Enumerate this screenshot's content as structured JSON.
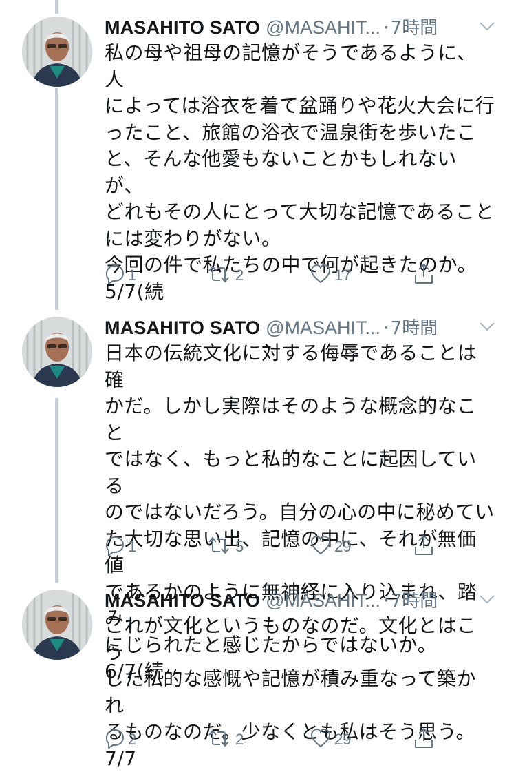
{
  "tweets": [
    {
      "name": "MASAHITO SATO",
      "handle": "@MASAHIT...",
      "dot": "·",
      "time": "7時間",
      "text": "私の母や祖母の記憶がそうであるように、人\nによっては浴衣を着て盆踊りや花火大会に行\nったこと、旅館の浴衣で温泉街を歩いたこ\nと、そんな他愛もないことかもしれないが、\nどれもその人にとって大切な記憶であること\nには変わりがない。\n今回の件で私たちの中で何が起きたのか。\n5/7(続",
      "replies": "1",
      "retweets": "2",
      "likes": "17"
    },
    {
      "name": "MASAHITO SATO",
      "handle": "@MASAHIT...",
      "dot": "·",
      "time": "7時間",
      "text": "日本の伝統文化に対する侮辱であることは確\nかだ。しかし実際はそのような概念的なこと\nではなく、もっと私的なことに起因している\nのではないだろう。自分の心の中に秘めてい\nた大切な思い出、記憶の中に、それが無価値\nであるかのように無神経に入り込まれ、踏み\nにじられたと感じたからではないか。6/7(続",
      "replies": "1",
      "retweets": "5",
      "likes": "29"
    },
    {
      "name": "MASAHITO SATO",
      "handle": "@MASAHIT...",
      "dot": "·",
      "time": "7時間",
      "text": "これが文化というものなのだ。文化とはこう\nした私的な感慨や記憶が積み重なって築かれ\nるものなのだ。少なくとも私はそう思う。\n7/7",
      "replies": "2",
      "retweets": "2",
      "likes": "29"
    }
  ],
  "icons": {
    "reply": "reply-icon",
    "retweet": "retweet-icon",
    "like": "heart-icon",
    "share": "share-icon",
    "caret": "chevron-down-icon"
  },
  "colors": {
    "text": "#14171a",
    "secondary": "#657786",
    "thread_line": "#c9d1d8"
  }
}
